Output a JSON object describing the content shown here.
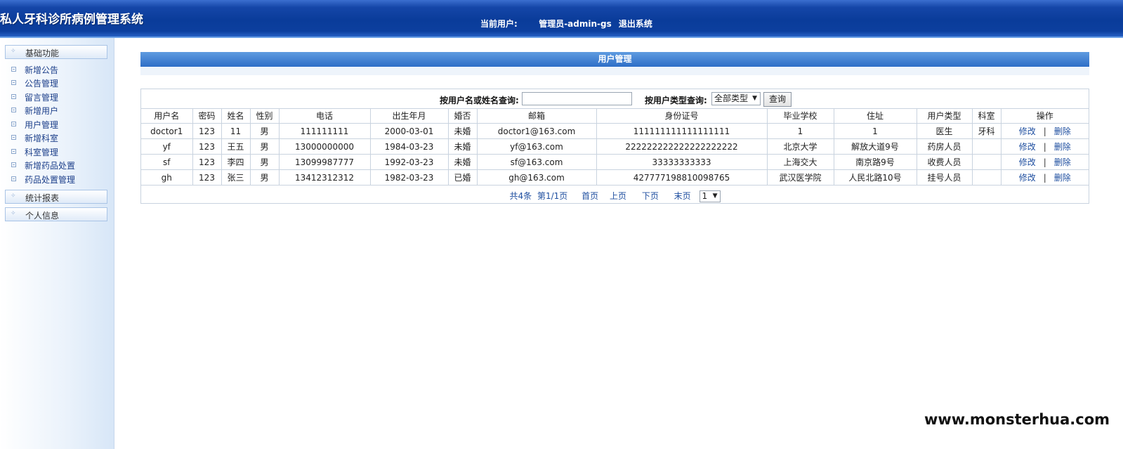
{
  "header": {
    "system_title": "私人牙科诊所病例管理系统",
    "current_user_label": "当前用户:",
    "current_user_value": "管理员-admin-gs",
    "logout_label": "退出系统"
  },
  "sidebar": {
    "groups": [
      {
        "label": "基础功能"
      },
      {
        "label": "统计报表"
      },
      {
        "label": "个人信息"
      }
    ],
    "items": [
      {
        "label": "新增公告"
      },
      {
        "label": "公告管理"
      },
      {
        "label": "留言管理"
      },
      {
        "label": "新增用户"
      },
      {
        "label": "用户管理"
      },
      {
        "label": "新增科室"
      },
      {
        "label": "科室管理"
      },
      {
        "label": "新增药品处置"
      },
      {
        "label": "药品处置管理"
      }
    ]
  },
  "main": {
    "section_title": "用户管理",
    "search": {
      "name_label": "按用户名或姓名查询:",
      "name_value": "",
      "type_label": "按用户类型查询:",
      "type_selected": "全部类型",
      "query_button": "查询"
    },
    "table": {
      "headers": [
        "用户名",
        "密码",
        "姓名",
        "性别",
        "电话",
        "出生年月",
        "婚否",
        "邮箱",
        "身份证号",
        "毕业学校",
        "住址",
        "用户类型",
        "科室",
        "操作"
      ],
      "rows": [
        [
          "doctor1",
          "123",
          "11",
          "男",
          "111111111",
          "2000-03-01",
          "未婚",
          "doctor1@163.com",
          "111111111111111111",
          "1",
          "1",
          "医生",
          "牙科"
        ],
        [
          "yf",
          "123",
          "王五",
          "男",
          "13000000000",
          "1984-03-23",
          "未婚",
          "yf@163.com",
          "222222222222222222222",
          "北京大学",
          "解放大道9号",
          "药房人员",
          ""
        ],
        [
          "sf",
          "123",
          "李四",
          "男",
          "13099987777",
          "1992-03-23",
          "未婚",
          "sf@163.com",
          "33333333333",
          "上海交大",
          "南京路9号",
          "收费人员",
          ""
        ],
        [
          "gh",
          "123",
          "张三",
          "男",
          "13412312312",
          "1982-03-23",
          "已婚",
          "gh@163.com",
          "427777198810098765",
          "武汉医学院",
          "人民北路10号",
          "挂号人员",
          ""
        ]
      ],
      "edit_label": "修改",
      "op_separator": "|",
      "delete_label": "删除"
    },
    "pager": {
      "total": "共4条",
      "page_info": "第1/1页",
      "first": "首页",
      "prev": "上页",
      "next": "下页",
      "last": "末页",
      "page_select": "1"
    }
  },
  "watermark": "www.monsterhua.com"
}
